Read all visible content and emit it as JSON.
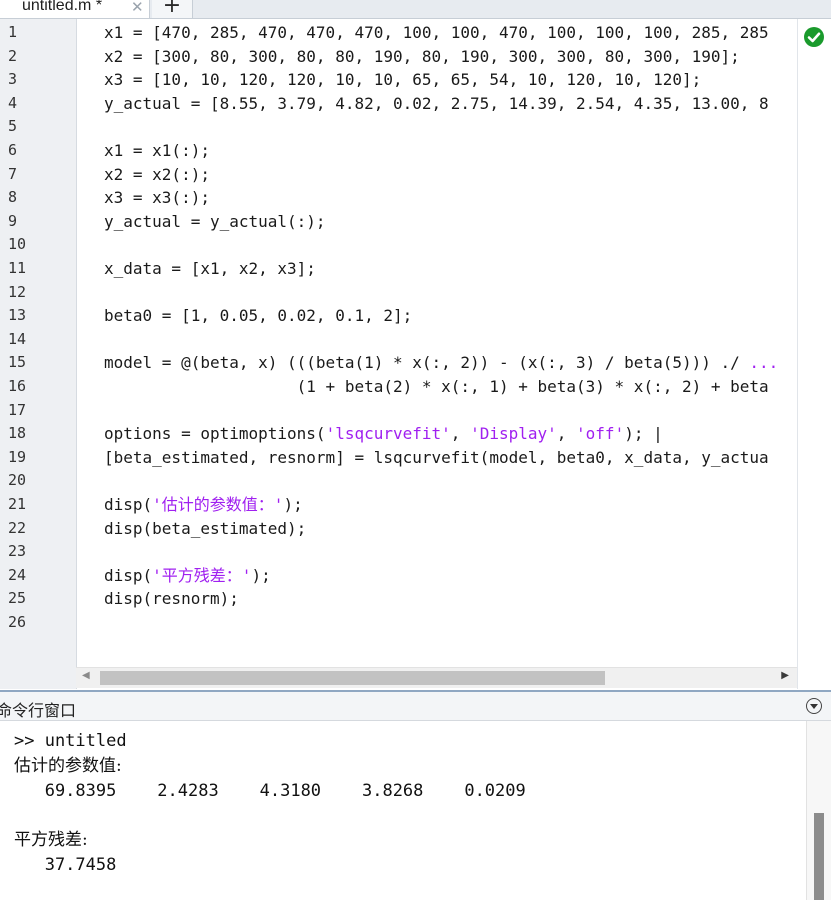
{
  "tab": {
    "title": "untitled.m *",
    "close": "✕",
    "new": "+"
  },
  "editor": {
    "lines": [
      {
        "n": "1",
        "segs": [
          {
            "t": "x1 = [470, 285, 470, 470, 470, 100, 100, 470, 100, 100, 100, 285, 285",
            "s": ""
          }
        ]
      },
      {
        "n": "2",
        "segs": [
          {
            "t": "x2 = [300, 80, 300, 80, 80, 190, 80, 190, 300, 300, 80, 300, 190];",
            "s": ""
          }
        ]
      },
      {
        "n": "3",
        "segs": [
          {
            "t": "x3 = [10, 10, 120, 120, 10, 10, 65, 65, 54, 10, 120, 10, 120];",
            "s": ""
          }
        ]
      },
      {
        "n": "4",
        "segs": [
          {
            "t": "y_actual = [8.55, 3.79, 4.82, 0.02, 2.75, 14.39, 2.54, 4.35, 13.00, 8",
            "s": ""
          }
        ]
      },
      {
        "n": "5",
        "segs": []
      },
      {
        "n": "6",
        "segs": [
          {
            "t": "x1 = x1(:);",
            "s": ""
          }
        ]
      },
      {
        "n": "7",
        "segs": [
          {
            "t": "x2 = x2(:);",
            "s": ""
          }
        ]
      },
      {
        "n": "8",
        "segs": [
          {
            "t": "x3 = x3(:);",
            "s": ""
          }
        ]
      },
      {
        "n": "9",
        "segs": [
          {
            "t": "y_actual = y_actual(:);",
            "s": ""
          }
        ]
      },
      {
        "n": "10",
        "segs": []
      },
      {
        "n": "11",
        "segs": [
          {
            "t": "x_data = [x1, x2, x3];",
            "s": ""
          }
        ]
      },
      {
        "n": "12",
        "segs": []
      },
      {
        "n": "13",
        "segs": [
          {
            "t": "beta0 = [1, 0.05, 0.02, 0.1, 2];",
            "s": ""
          }
        ]
      },
      {
        "n": "14",
        "segs": []
      },
      {
        "n": "15",
        "segs": [
          {
            "t": "model = @(beta, x) (((beta(1) * x(:, 2)) - (x(:, 3) / beta(5))) ./ ",
            "s": ""
          },
          {
            "t": "...",
            "s": "str"
          }
        ]
      },
      {
        "n": "16",
        "segs": [
          {
            "t": "                    (1 + beta(2) * x(:, 1) + beta(3) * x(:, 2) + beta",
            "s": ""
          }
        ]
      },
      {
        "n": "17",
        "segs": []
      },
      {
        "n": "18",
        "segs": [
          {
            "t": "options = optimoptions(",
            "s": ""
          },
          {
            "t": "'lsqcurvefit'",
            "s": "str"
          },
          {
            "t": ", ",
            "s": ""
          },
          {
            "t": "'Display'",
            "s": "str"
          },
          {
            "t": ", ",
            "s": ""
          },
          {
            "t": "'off'",
            "s": "str"
          },
          {
            "t": "); |",
            "s": ""
          }
        ]
      },
      {
        "n": "19",
        "segs": [
          {
            "t": "[beta_estimated, resnorm] = lsqcurvefit(model, beta0, x_data, y_actua",
            "s": ""
          }
        ]
      },
      {
        "n": "20",
        "segs": []
      },
      {
        "n": "21",
        "segs": [
          {
            "t": "disp(",
            "s": ""
          },
          {
            "t": "'估计的参数值：'",
            "s": "str"
          },
          {
            "t": ");",
            "s": ""
          }
        ]
      },
      {
        "n": "22",
        "segs": [
          {
            "t": "disp(beta_estimated);",
            "s": ""
          }
        ]
      },
      {
        "n": "23",
        "segs": []
      },
      {
        "n": "24",
        "segs": [
          {
            "t": "disp(",
            "s": ""
          },
          {
            "t": "'平方残差：'",
            "s": "str"
          },
          {
            "t": ");",
            "s": ""
          }
        ]
      },
      {
        "n": "25",
        "segs": [
          {
            "t": "disp(resnorm);",
            "s": ""
          }
        ]
      },
      {
        "n": "26",
        "segs": []
      }
    ],
    "status_icon": "check-circle-icon",
    "status_color": "#1a9a2c"
  },
  "command_window": {
    "title": "命令行窗口",
    "prompt_line": ">> untitled",
    "output": [
      "估计的参数值:",
      "   69.8395    2.4283    4.3180    3.8268    0.0209",
      "",
      "平方残差:",
      "   37.7458"
    ]
  }
}
